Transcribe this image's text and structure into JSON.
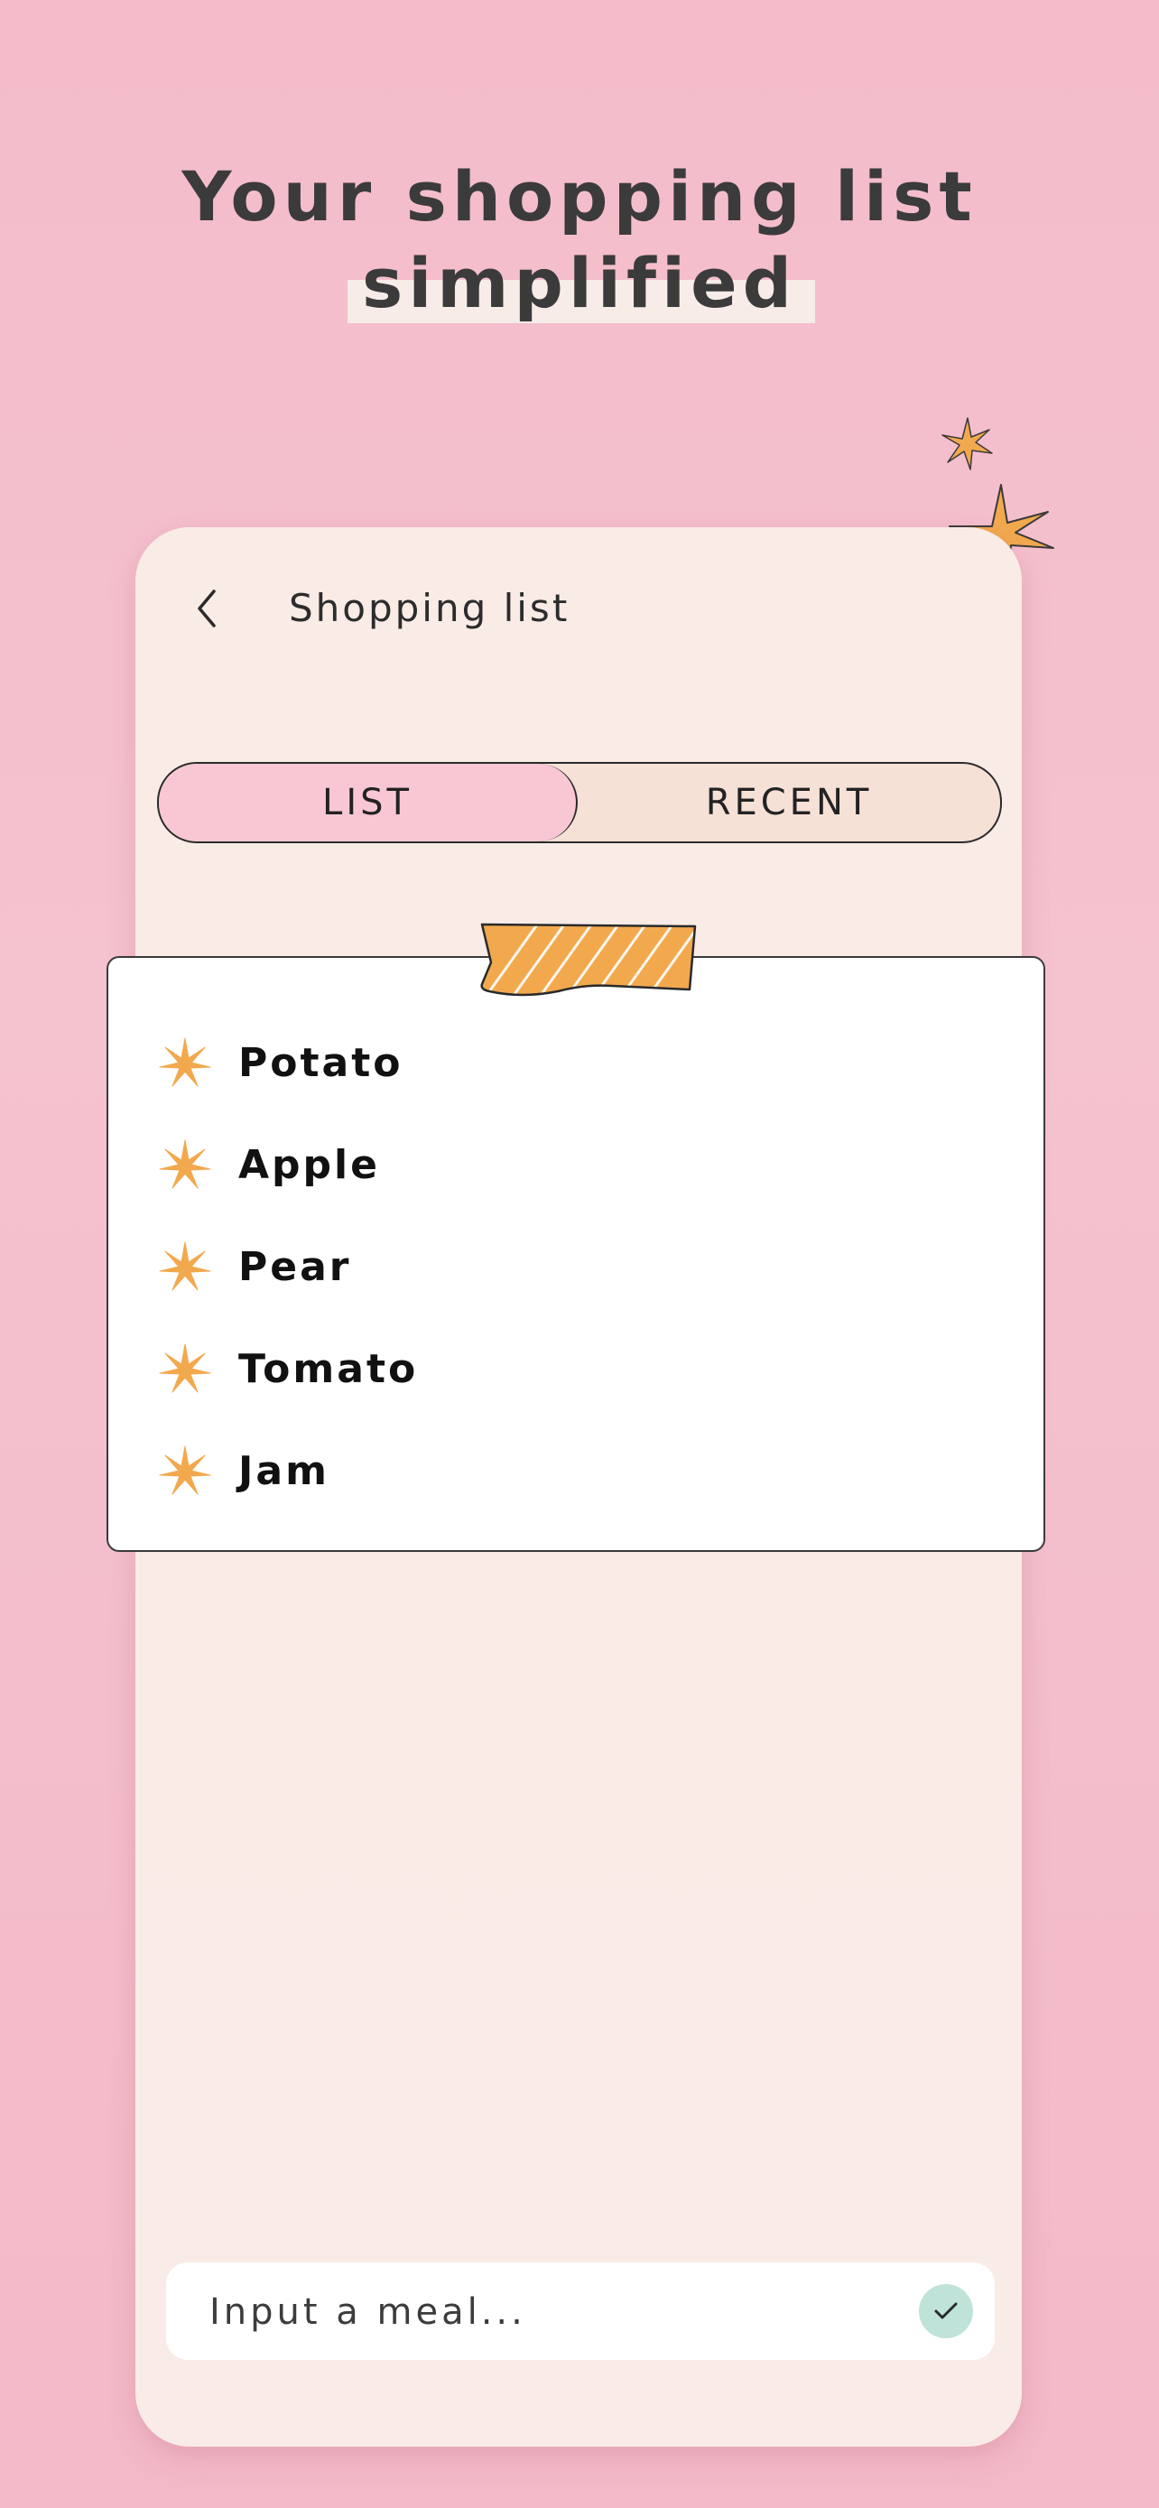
{
  "headline": {
    "line1": "Your shopping list",
    "line2": "simplified"
  },
  "screen": {
    "title": "Shopping list",
    "back_icon": "chevron-left-icon"
  },
  "tabs": [
    {
      "label": "LIST",
      "active": true
    },
    {
      "label": "RECENT",
      "active": false
    }
  ],
  "list": {
    "bullet_icon": "sparkle-icon",
    "items": [
      {
        "label": "Potato"
      },
      {
        "label": "Apple"
      },
      {
        "label": "Pear"
      },
      {
        "label": "Tomato"
      },
      {
        "label": "Jam"
      }
    ]
  },
  "meal_input": {
    "placeholder": "Input a meal...",
    "value": "",
    "confirm_icon": "check-icon"
  },
  "colors": {
    "background": "#f4bcca",
    "phone": "#f9ebe6",
    "tab_active": "#f9c7d4",
    "tab_inactive": "#f5e1d6",
    "accent_orange": "#f2a94e",
    "confirm_green": "#bfe3d8"
  }
}
